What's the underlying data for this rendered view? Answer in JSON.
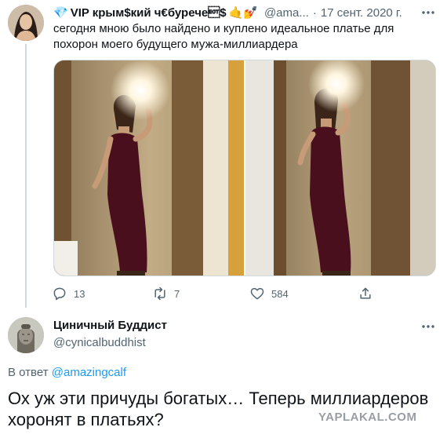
{
  "tweet1": {
    "author_name": "VIP крым$кий ч€бурече\u0004$",
    "name_prefix_emoji": "💎",
    "name_suffix_emoji": "🤙💅",
    "handle": "@ama...",
    "separator": "·",
    "date": "17 сент. 2020 г.",
    "text": "сегодня мною было найдено и куплено идеальное платье для похорон моего будущего мужа-миллиардера",
    "actions": {
      "replies": "13",
      "retweets": "7",
      "likes": "584"
    }
  },
  "tweet2": {
    "author_name": "Циничный Буддист",
    "handle": "@cynicalbuddhist",
    "reply_prefix": "В ответ",
    "reply_mention": "@amazingcalf",
    "text": "Ох уж эти причуды богатых… Теперь миллиардеров хоронят в платьях?"
  },
  "watermark": "YAPLAKAL.COM",
  "icons": {
    "more": "more-dots-icon",
    "reply": "reply-icon",
    "retweet": "retweet-icon",
    "like": "heart-icon",
    "share": "share-icon"
  },
  "colors": {
    "text": "#0f1419",
    "secondary": "#536471",
    "link": "#1d9bf0",
    "divider": "#cfd9de",
    "dress": "#4a0f1c"
  }
}
